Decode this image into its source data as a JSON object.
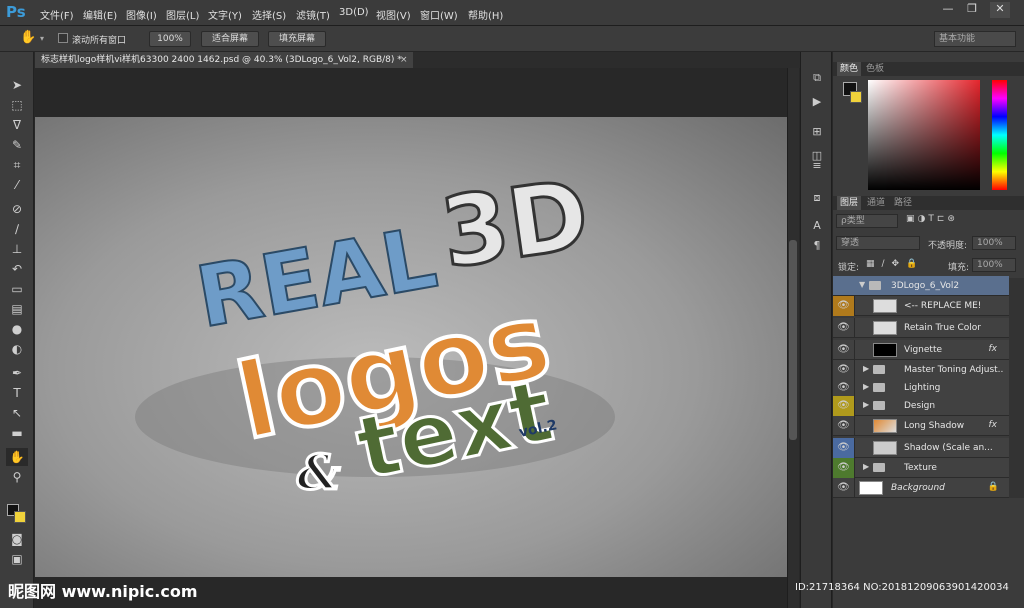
{
  "menubar": {
    "app_logo": "Ps",
    "items": [
      "文件(F)",
      "编辑(E)",
      "图像(I)",
      "图层(L)",
      "文字(Y)",
      "选择(S)",
      "滤镜(T)",
      "3D(D)",
      "视图(V)",
      "窗口(W)",
      "帮助(H)"
    ],
    "win_minimize": "—",
    "win_restore": "❐",
    "win_close": "✕"
  },
  "options": {
    "scroll_all_label": "滚动所有窗口",
    "zoom_100": "100%",
    "fit_screen": "适合屏幕",
    "fill_screen": "填充屏幕",
    "workspace": "基本功能"
  },
  "document": {
    "tab_title": "标志样机logo样机vi样机63300 2400 1462.psd @ 40.3% (3DLogo_6_Vol2, RGB/8) *",
    "close": "×"
  },
  "artwork": {
    "line1": "REAL",
    "line1b": "3D",
    "line2": "logos",
    "amp": "&",
    "line3": "text",
    "vol": "vol.2"
  },
  "color_panel": {
    "tabs": [
      "颜色",
      "色板"
    ],
    "foreground": "#111111",
    "background": "#f0d23b"
  },
  "layers_panel": {
    "tabs": [
      "图层",
      "通道",
      "路径"
    ],
    "filter_label": "ρ类型",
    "blend_mode": "穿透",
    "opacity_label": "不透明度:",
    "opacity_value": "100%",
    "lock_label": "锁定:",
    "fill_label": "填充:",
    "fill_value": "100%",
    "group_name": "3DLogo_6_Vol2",
    "layers": [
      {
        "name": "<-- REPLACE ME!",
        "eye_color": "#b07a1c",
        "type": "smart",
        "fx": ""
      },
      {
        "name": "Retain True Color",
        "eye_color": "",
        "type": "smart",
        "fx": ""
      },
      {
        "name": "Vignette",
        "eye_color": "",
        "type": "black",
        "fx": "fx"
      },
      {
        "name": "Master Toning Adjust...",
        "eye_color": "",
        "type": "folder",
        "fx": ""
      },
      {
        "name": "Lighting",
        "eye_color": "",
        "type": "folder",
        "fx": ""
      },
      {
        "name": "Design",
        "eye_color": "#b09a1c",
        "type": "folder",
        "fx": ""
      },
      {
        "name": "Long Shadow",
        "eye_color": "",
        "type": "smart",
        "fx": "fx"
      },
      {
        "name": "Shadow (Scale an...",
        "eye_color": "#4a6aa0",
        "type": "smart",
        "fx": ""
      },
      {
        "name": "Texture",
        "eye_color": "#4e7a2e",
        "type": "folder",
        "fx": ""
      },
      {
        "name": "Background",
        "eye_color": "",
        "type": "white",
        "fx": ""
      }
    ]
  },
  "watermark": {
    "brand": "昵图网 www.nipic.com",
    "id_text": "ID:21718364 NO:20181209063901420034"
  }
}
